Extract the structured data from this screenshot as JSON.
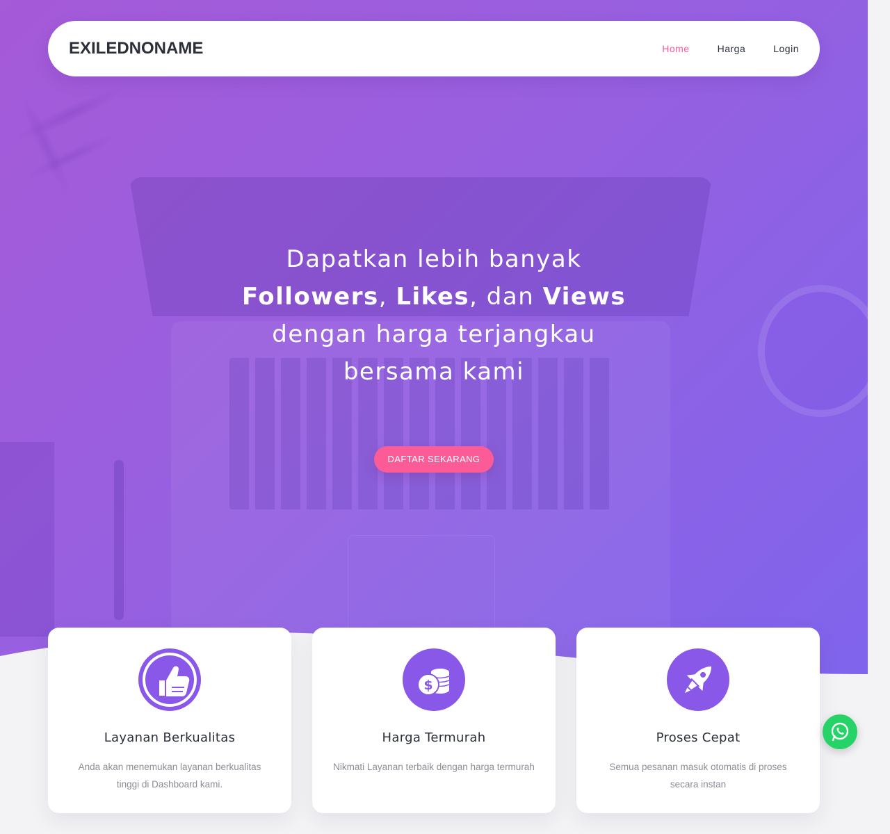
{
  "navbar": {
    "brand": "EXILEDNONAME",
    "links": [
      {
        "label": "Home",
        "active": true
      },
      {
        "label": "Harga",
        "active": false
      },
      {
        "label": "Login",
        "active": false
      }
    ]
  },
  "hero": {
    "line1": "Dapatkan lebih banyak",
    "highlight1": "Followers",
    "sep1": ", ",
    "highlight2": "Likes",
    "sep2": ", dan ",
    "highlight3": "Views",
    "line3": "dengan harga terjangkau",
    "line4": "bersama kami",
    "cta_label": "DAFTAR SEKARANG"
  },
  "features": [
    {
      "icon": "thumbs-up-icon",
      "title": "Layanan Berkualitas",
      "description": "Anda akan menemukan layanan berkualitas tinggi di Dashboard kami."
    },
    {
      "icon": "coins-dollar-icon",
      "title": "Harga Termurah",
      "description": "Nikmati Layanan terbaik dengan harga termurah"
    },
    {
      "icon": "rocket-icon",
      "title": "Proses Cepat",
      "description": "Semua pesanan masuk otomatis di proses secara instan"
    }
  ],
  "floating": {
    "icon": "whatsapp-icon"
  },
  "colors": {
    "accent_pink": "#f7599b",
    "cta_pink": "#fb5c97",
    "icon_purple": "#8a58e8",
    "hero_start": "#a55ad8",
    "hero_end": "#7f64ec",
    "whatsapp_green": "#25d366"
  }
}
